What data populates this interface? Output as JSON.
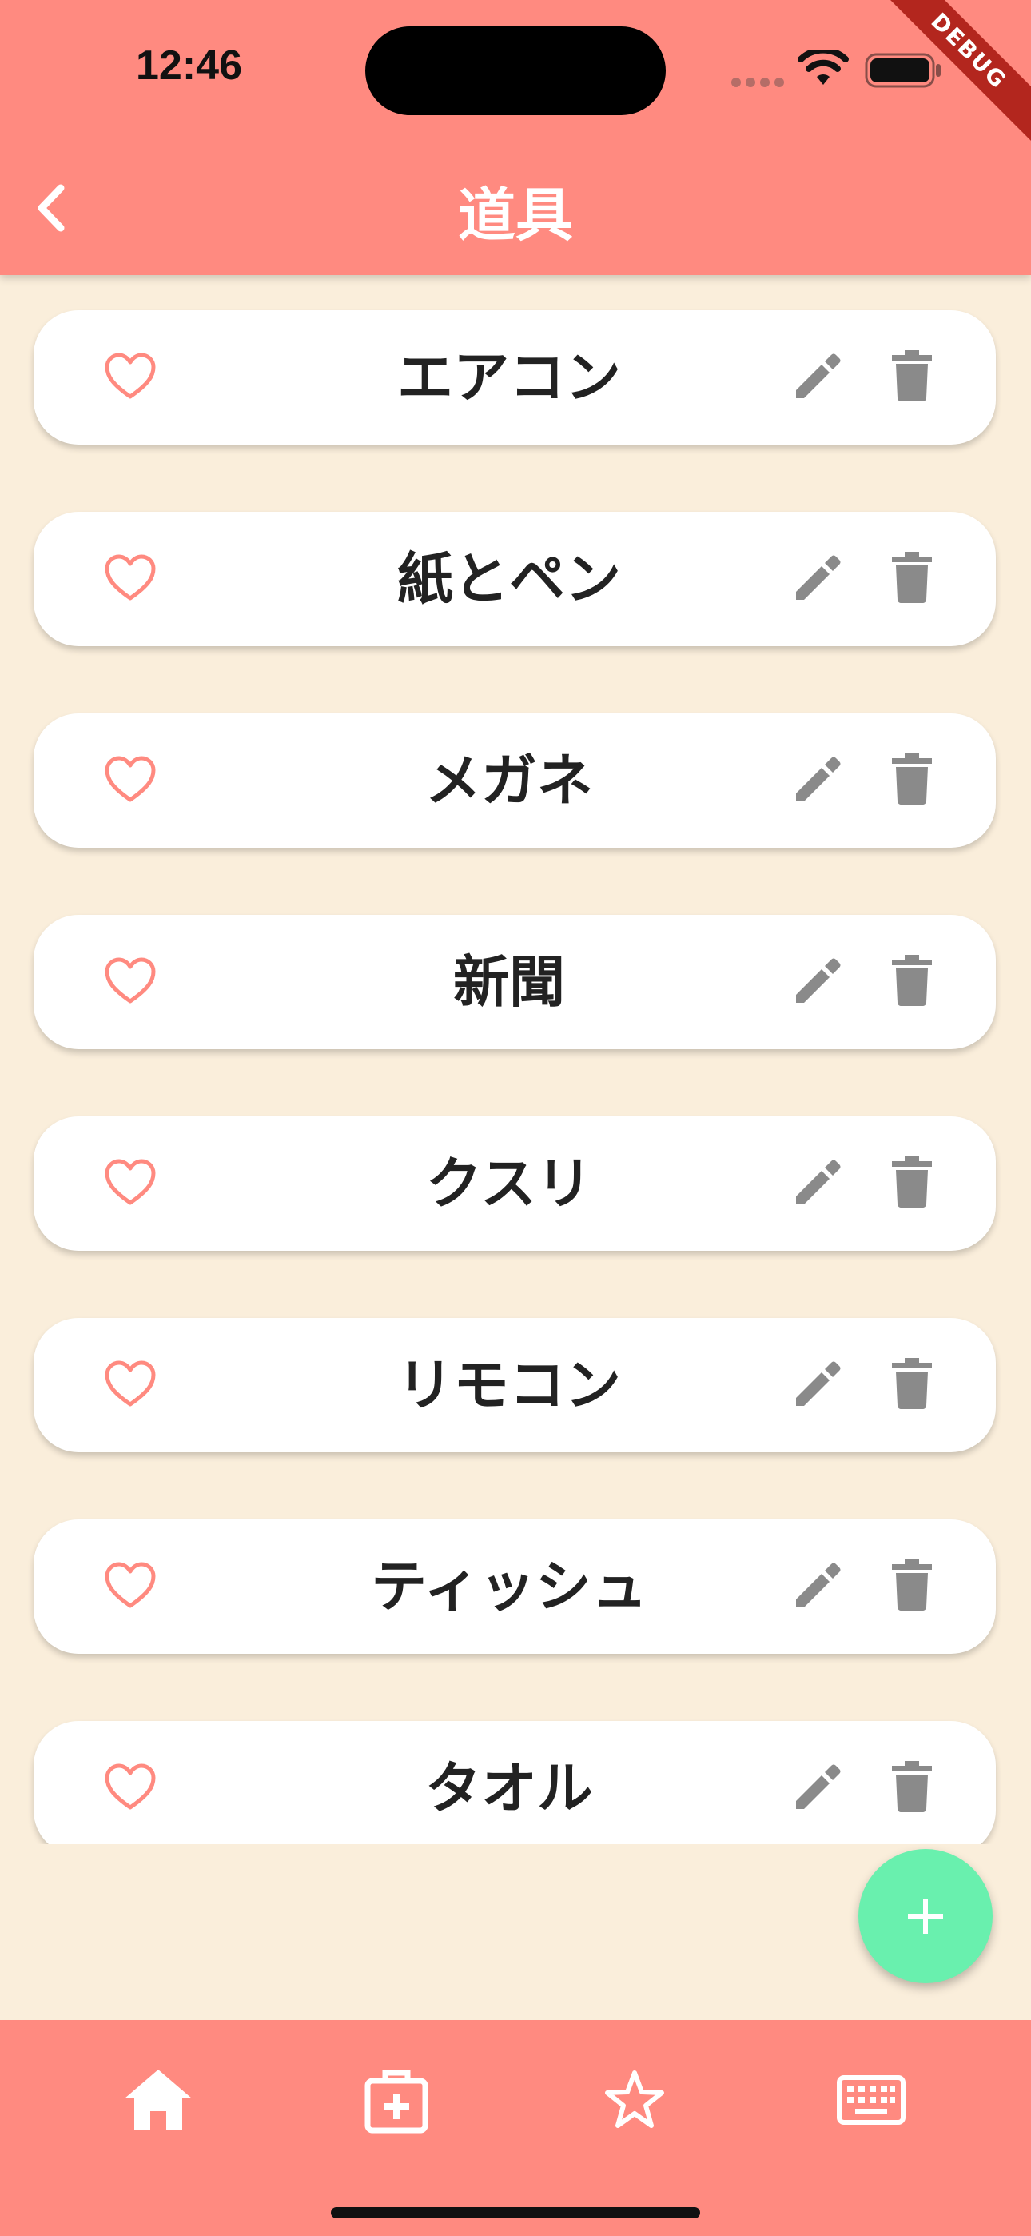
{
  "status_bar": {
    "time": "12:46"
  },
  "debug_banner": "DEBUG",
  "app_bar": {
    "title": "道具"
  },
  "items": [
    {
      "name": "エアコン"
    },
    {
      "name": "紙とペン"
    },
    {
      "name": "メガネ"
    },
    {
      "name": "新聞"
    },
    {
      "name": "クスリ"
    },
    {
      "name": "リモコン"
    },
    {
      "name": "ティッシュ"
    },
    {
      "name": "タオル"
    }
  ],
  "icons": {
    "back": "chevron-left-icon",
    "favorite": "heart-outline-icon",
    "edit": "pencil-icon",
    "delete": "trash-icon",
    "add": "plus-icon"
  },
  "bottom_nav": [
    {
      "icon": "home-icon"
    },
    {
      "icon": "medical-kit-icon"
    },
    {
      "icon": "star-outline-icon"
    },
    {
      "icon": "keyboard-icon"
    }
  ],
  "colors": {
    "app_bar": "#FF8A80",
    "background": "#FAEEDB",
    "fab": "#69F0AE",
    "heart": "#FF8A80",
    "action_icons": "#8A8A8A"
  }
}
